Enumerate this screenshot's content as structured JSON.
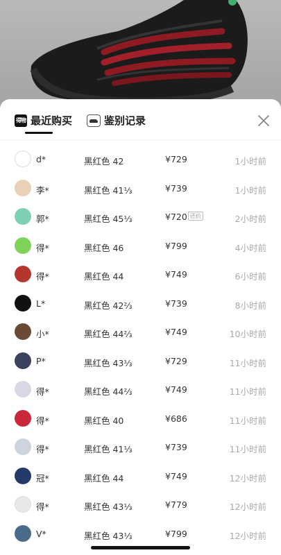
{
  "tabs": {
    "brand_mark": "得物",
    "recent_label": "最近购买",
    "appraisal_label": "鉴别记录"
  },
  "records": [
    {
      "name": "d*",
      "spec": "黑红色 42",
      "price": "¥729",
      "tag": "",
      "time": "1小时前",
      "avatar_color": "#ffffff"
    },
    {
      "name": "李*",
      "spec": "黑红色 41⅓",
      "price": "¥739",
      "tag": "",
      "time": "1小时前",
      "avatar_color": "#e9d1b8"
    },
    {
      "name": "郭*",
      "spec": "黑红色 45⅓",
      "price": "¥720",
      "tag": "还价",
      "time": "2小时前",
      "avatar_color": "#7fcfb6"
    },
    {
      "name": "得*",
      "spec": "黑红色 46",
      "price": "¥799",
      "tag": "",
      "time": "4小时前",
      "avatar_color": "#7fd35a"
    },
    {
      "name": "得*",
      "spec": "黑红色 44",
      "price": "¥749",
      "tag": "",
      "time": "6小时前",
      "avatar_color": "#b3372d"
    },
    {
      "name": "L*",
      "spec": "黑红色 42⅔",
      "price": "¥739",
      "tag": "",
      "time": "8小时前",
      "avatar_color": "#111111"
    },
    {
      "name": "小*",
      "spec": "黑红色 44⅔",
      "price": "¥749",
      "tag": "",
      "time": "10小时前",
      "avatar_color": "#6b4a35"
    },
    {
      "name": "P*",
      "spec": "黑红色 43⅓",
      "price": "¥729",
      "tag": "",
      "time": "11小时前",
      "avatar_color": "#3b4260"
    },
    {
      "name": "得*",
      "spec": "黑红色 44⅔",
      "price": "¥749",
      "tag": "",
      "time": "11小时前",
      "avatar_color": "#d9d9e6"
    },
    {
      "name": "得*",
      "spec": "黑红色 40",
      "price": "¥686",
      "tag": "",
      "time": "11小时前",
      "avatar_color": "#c8283a"
    },
    {
      "name": "得*",
      "spec": "黑红色 41⅓",
      "price": "¥739",
      "tag": "",
      "time": "11小时前",
      "avatar_color": "#cfd3de"
    },
    {
      "name": "冠*",
      "spec": "黑红色 44",
      "price": "¥749",
      "tag": "",
      "time": "12小时前",
      "avatar_color": "#243a6b"
    },
    {
      "name": "得*",
      "spec": "黑红色 43⅓",
      "price": "¥779",
      "tag": "",
      "time": "12小时前",
      "avatar_color": "#e8e8e8"
    },
    {
      "name": "V*",
      "spec": "黑红色 43⅓",
      "price": "¥799",
      "tag": "",
      "time": "12小时前",
      "avatar_color": "#4a6b8a"
    }
  ]
}
